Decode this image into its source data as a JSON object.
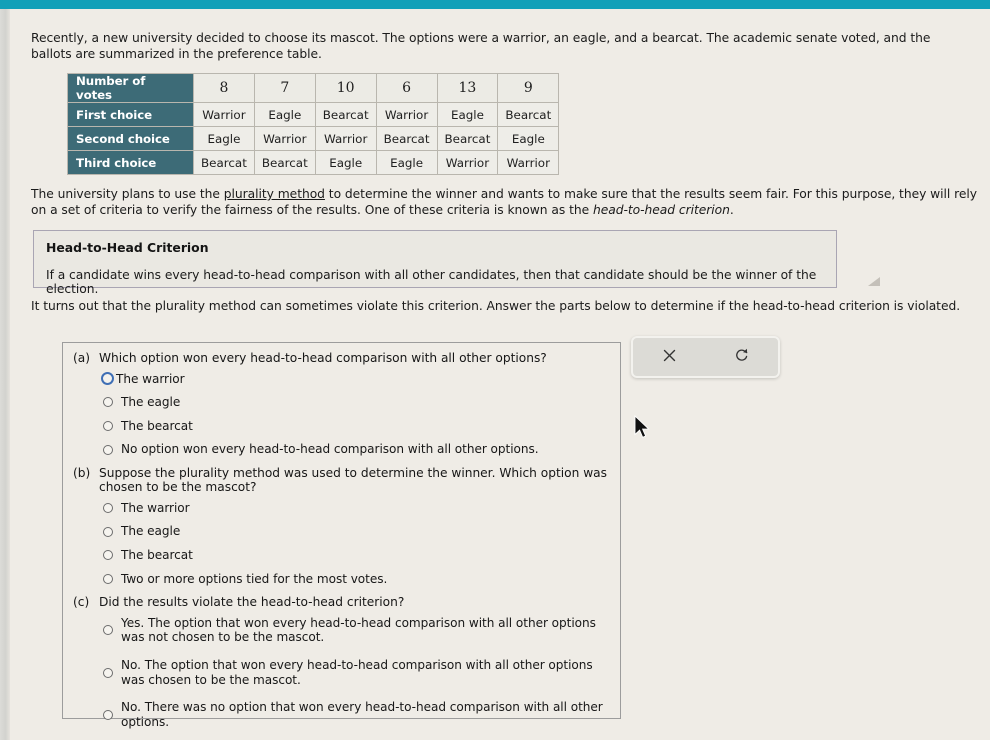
{
  "chrome": {
    "collapse_tab_icon": "chevron-down-icon",
    "accent_color": "#12a0b8"
  },
  "intro": {
    "text": "Recently, a new university decided to choose its mascot. The options were a warrior, an eagle, and a bearcat. The academic senate voted, and the ballots are summarized in the preference table."
  },
  "preference_table": {
    "row_headers": [
      "Number of votes",
      "First choice",
      "Second choice",
      "Third choice"
    ],
    "votes": [
      "8",
      "7",
      "10",
      "6",
      "13",
      "9"
    ],
    "first_choice": [
      "Warrior",
      "Eagle",
      "Bearcat",
      "Warrior",
      "Eagle",
      "Bearcat"
    ],
    "second_choice": [
      "Eagle",
      "Warrior",
      "Warrior",
      "Bearcat",
      "Bearcat",
      "Eagle"
    ],
    "third_choice": [
      "Bearcat",
      "Bearcat",
      "Eagle",
      "Eagle",
      "Warrior",
      "Warrior"
    ],
    "header_color": "#3d6b77"
  },
  "plan_paragraph": {
    "part1": "The university plans to use the ",
    "link": "plurality method",
    "part2": " to determine the winner and wants to make sure that the results seem fair. For this purpose, they will rely on a set of criteria to verify the fairness of the results. One of these criteria is known as the ",
    "italic": "head-to-head criterion",
    "part3": "."
  },
  "criterion_box": {
    "title": "Head-to-Head Criterion",
    "body": "If a candidate wins every head-to-head comparison with all other candidates, then that candidate should be the winner of the election."
  },
  "turns_out": {
    "text": "It turns out that the plurality method can sometimes violate this criterion. Answer the parts below to determine if the head-to-head criterion is violated."
  },
  "questions": [
    {
      "label": "(a)",
      "prompt": "Which option won every head-to-head comparison with all other options?",
      "options": [
        {
          "text": "The warrior",
          "selected": false,
          "focused": true
        },
        {
          "text": "The eagle",
          "selected": false,
          "focused": false
        },
        {
          "text": "The bearcat",
          "selected": false,
          "focused": false
        },
        {
          "text": "No option won every head-to-head comparison with all other options.",
          "selected": false,
          "focused": false
        }
      ]
    },
    {
      "label": "(b)",
      "prompt": "Suppose the plurality method was used to determine the winner. Which option was chosen to be the mascot?",
      "options": [
        {
          "text": "The warrior",
          "selected": false,
          "focused": false
        },
        {
          "text": "The eagle",
          "selected": false,
          "focused": false
        },
        {
          "text": "The bearcat",
          "selected": false,
          "focused": false
        },
        {
          "text": "Two or more options tied for the most votes.",
          "selected": false,
          "focused": false
        }
      ]
    },
    {
      "label": "(c)",
      "prompt": "Did the results violate the head-to-head criterion?",
      "options": [
        {
          "text": "Yes. The option that won every head-to-head comparison with all other options was not chosen to be the mascot.",
          "selected": false,
          "focused": false
        },
        {
          "text": "No. The option that won every head-to-head comparison with all other options was chosen to be the mascot.",
          "selected": false,
          "focused": false
        },
        {
          "text": "No. There was no option that won every head-to-head comparison with all other options.",
          "selected": false,
          "focused": false
        }
      ]
    }
  ],
  "toolbar": {
    "clear_icon": "close-x-icon",
    "reset_icon": "refresh-undo-icon"
  }
}
